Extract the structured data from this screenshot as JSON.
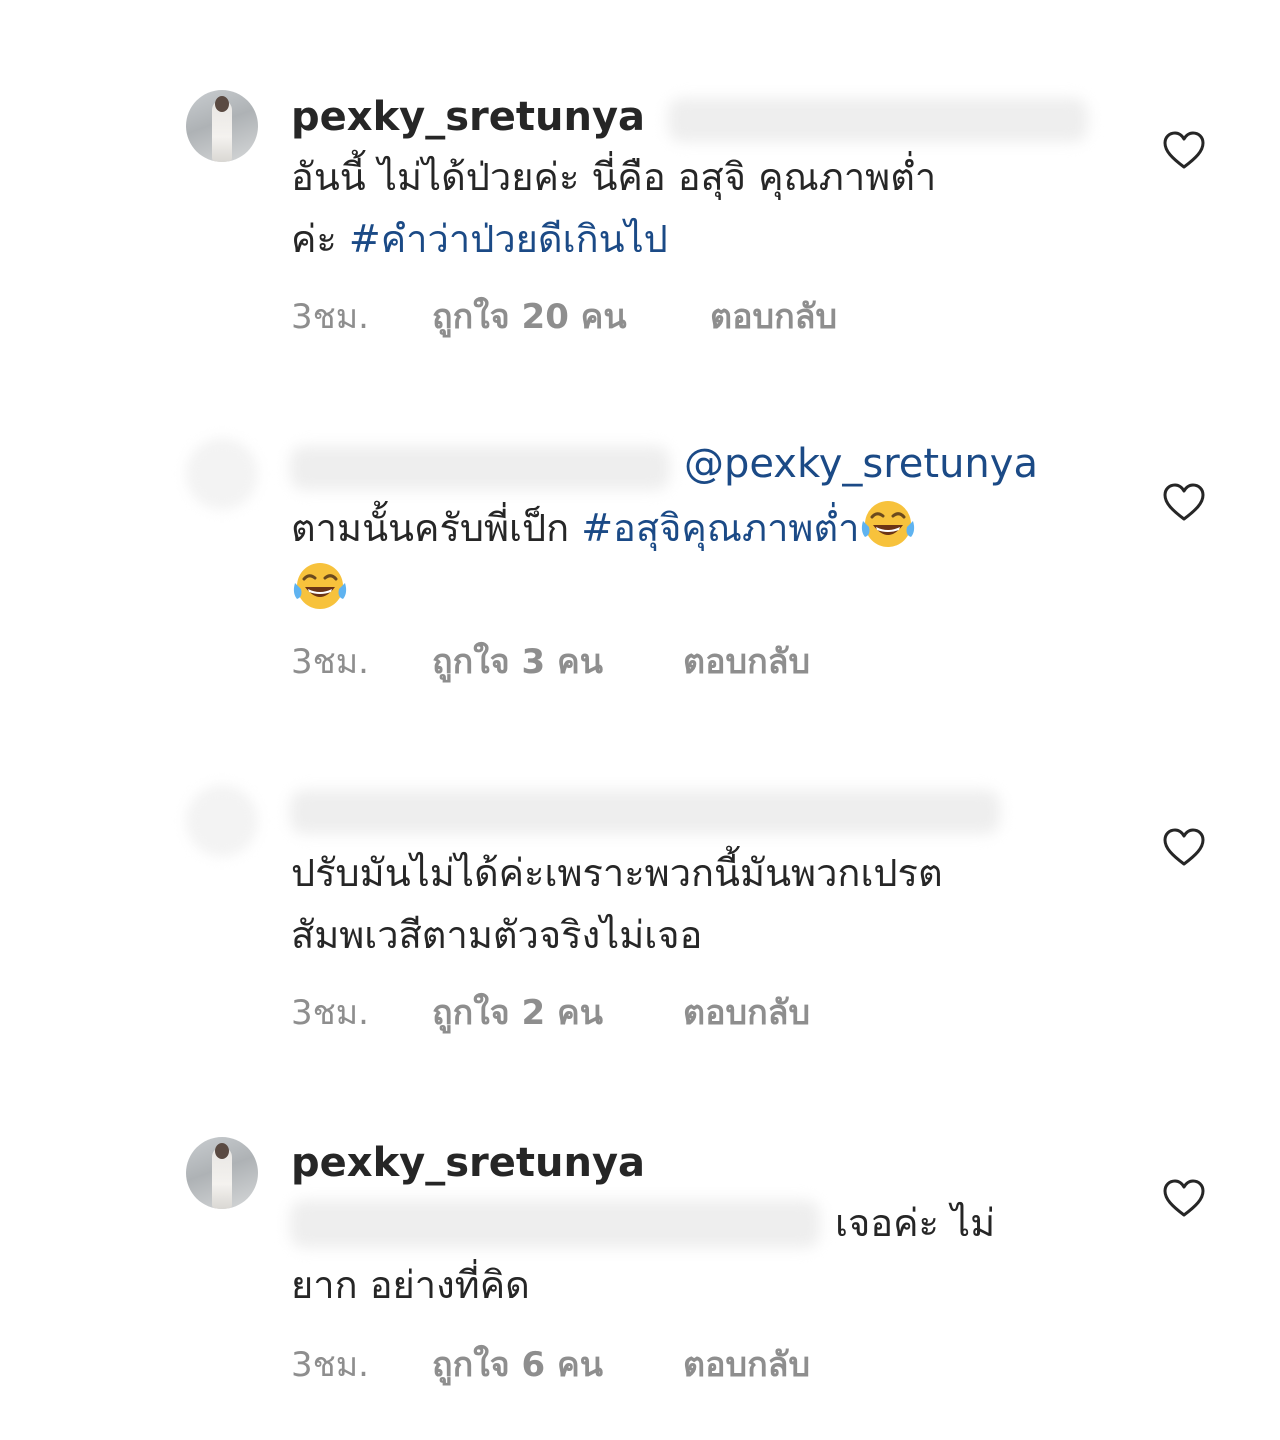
{
  "comments": [
    {
      "username": "pexky_sretunya",
      "text_line1": "อันนี้ ไม่ได้ป่วยค่ะ นี่คือ อสุจิ คุณภาพต่ำ",
      "text_line2_prefix": "ค่ะ  ",
      "hashtag": "#คำว่าป่วยดีเกินไป",
      "time": "3ชม.",
      "likes": "ถูกใจ 20 คน",
      "reply": "ตอบกลับ"
    },
    {
      "mention": "@pexky_sretunya",
      "text_prefix": "ตามนั้นครับพี่เป็ก ",
      "hashtag": "#อสุจิคุณภาพต่ำ",
      "emoji": "face-with-tears-of-joy",
      "time": "3ชม.",
      "likes": "ถูกใจ 3 คน",
      "reply": "ตอบกลับ"
    },
    {
      "text_line1": "ปรับมันไม่ได้ค่ะเพราะพวกนี้มันพวกเปรต",
      "text_line2": "สัมพเวสีตามตัวจริงไม่เจอ",
      "time": "3ชม.",
      "likes": "ถูกใจ 2 คน",
      "reply": "ตอบกลับ"
    },
    {
      "username": "pexky_sretunya",
      "text_line1": "เจอค่ะ ไม่",
      "text_line2": "ยาก  อย่างที่คิด",
      "time": "3ชม.",
      "likes": "ถูกใจ 6 คน",
      "reply": "ตอบกลับ"
    }
  ],
  "colors": {
    "text": "#262626",
    "link": "#1b4a86",
    "meta": "#8e8e8e"
  },
  "icons": {
    "like": "heart-outline-icon",
    "emoji": "face-with-tears-of-joy"
  }
}
